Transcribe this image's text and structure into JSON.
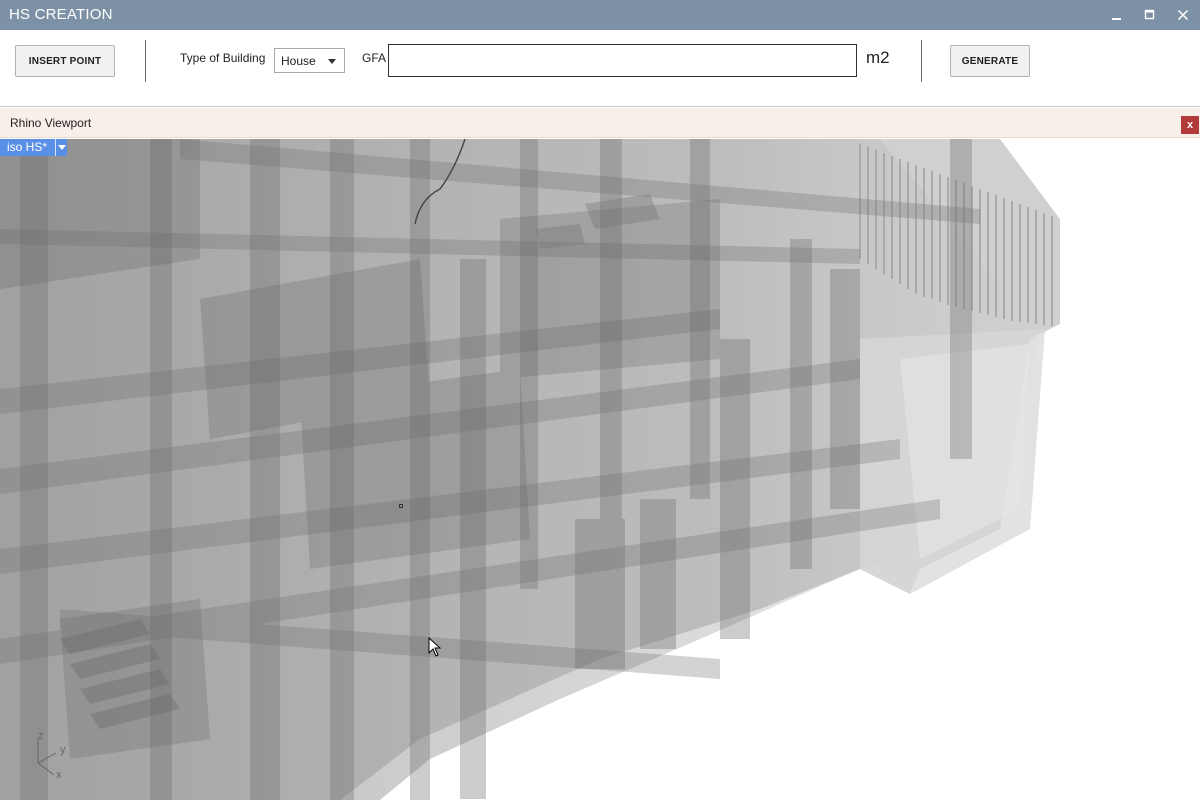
{
  "window": {
    "title": "HS CREATION",
    "controls": [
      "minimize-icon",
      "maximize-icon",
      "close-icon"
    ]
  },
  "toolbar": {
    "insert_point_label": "INSERT POINT",
    "type_of_building_label": "Type of Building",
    "building_type": {
      "selected": "House"
    },
    "gfa_label": "GFA",
    "gfa_value": "",
    "gfa_unit": "m2",
    "generate_label": "GENERATE"
  },
  "panel": {
    "title": "Rhino Viewport",
    "close_label": "x"
  },
  "viewport": {
    "view_name": "iso HS*",
    "axes": {
      "z": "z",
      "y": "y",
      "x": "x"
    }
  },
  "colors": {
    "titlebar": "#7d91a6",
    "panel_header": "#f9efe9",
    "viewport_tab": "#5a8fe6",
    "panel_close": "#b23a3a"
  }
}
